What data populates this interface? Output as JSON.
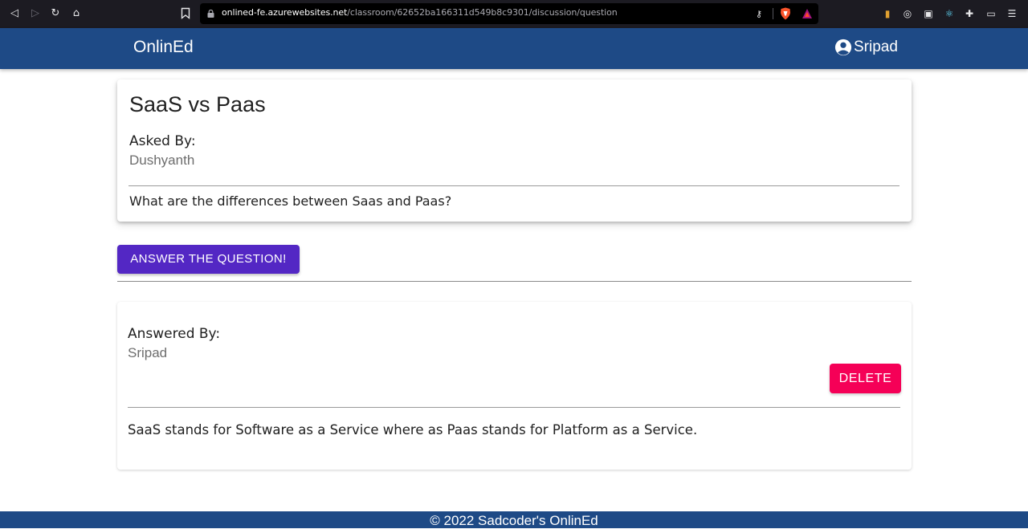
{
  "browser": {
    "url_host": "onlined-fe.azurewebsites.net",
    "url_path": "/classroom/62652ba166311d549b8c9301/discussion/question"
  },
  "header": {
    "brand": "OnlinEd",
    "user_name": "Sripad"
  },
  "question": {
    "title": "SaaS vs Paas",
    "asked_by_label": "Asked By:",
    "asked_by": "Dushyanth",
    "body": "What are the differences between Saas and Paas?"
  },
  "actions": {
    "answer_label": "ANSWER THE QUESTION!"
  },
  "answers": [
    {
      "answered_by_label": "Answered By:",
      "answered_by": "Sripad",
      "delete_label": "DELETE",
      "body": "SaaS stands for Software as a Service where as Paas stands for Platform as a Service."
    }
  ],
  "footer": {
    "text": "© 2022 Sadcoder's OnlinEd"
  },
  "colors": {
    "appbar": "#1e4a86",
    "answer_button": "#5327c4",
    "delete_button": "#f50057"
  }
}
